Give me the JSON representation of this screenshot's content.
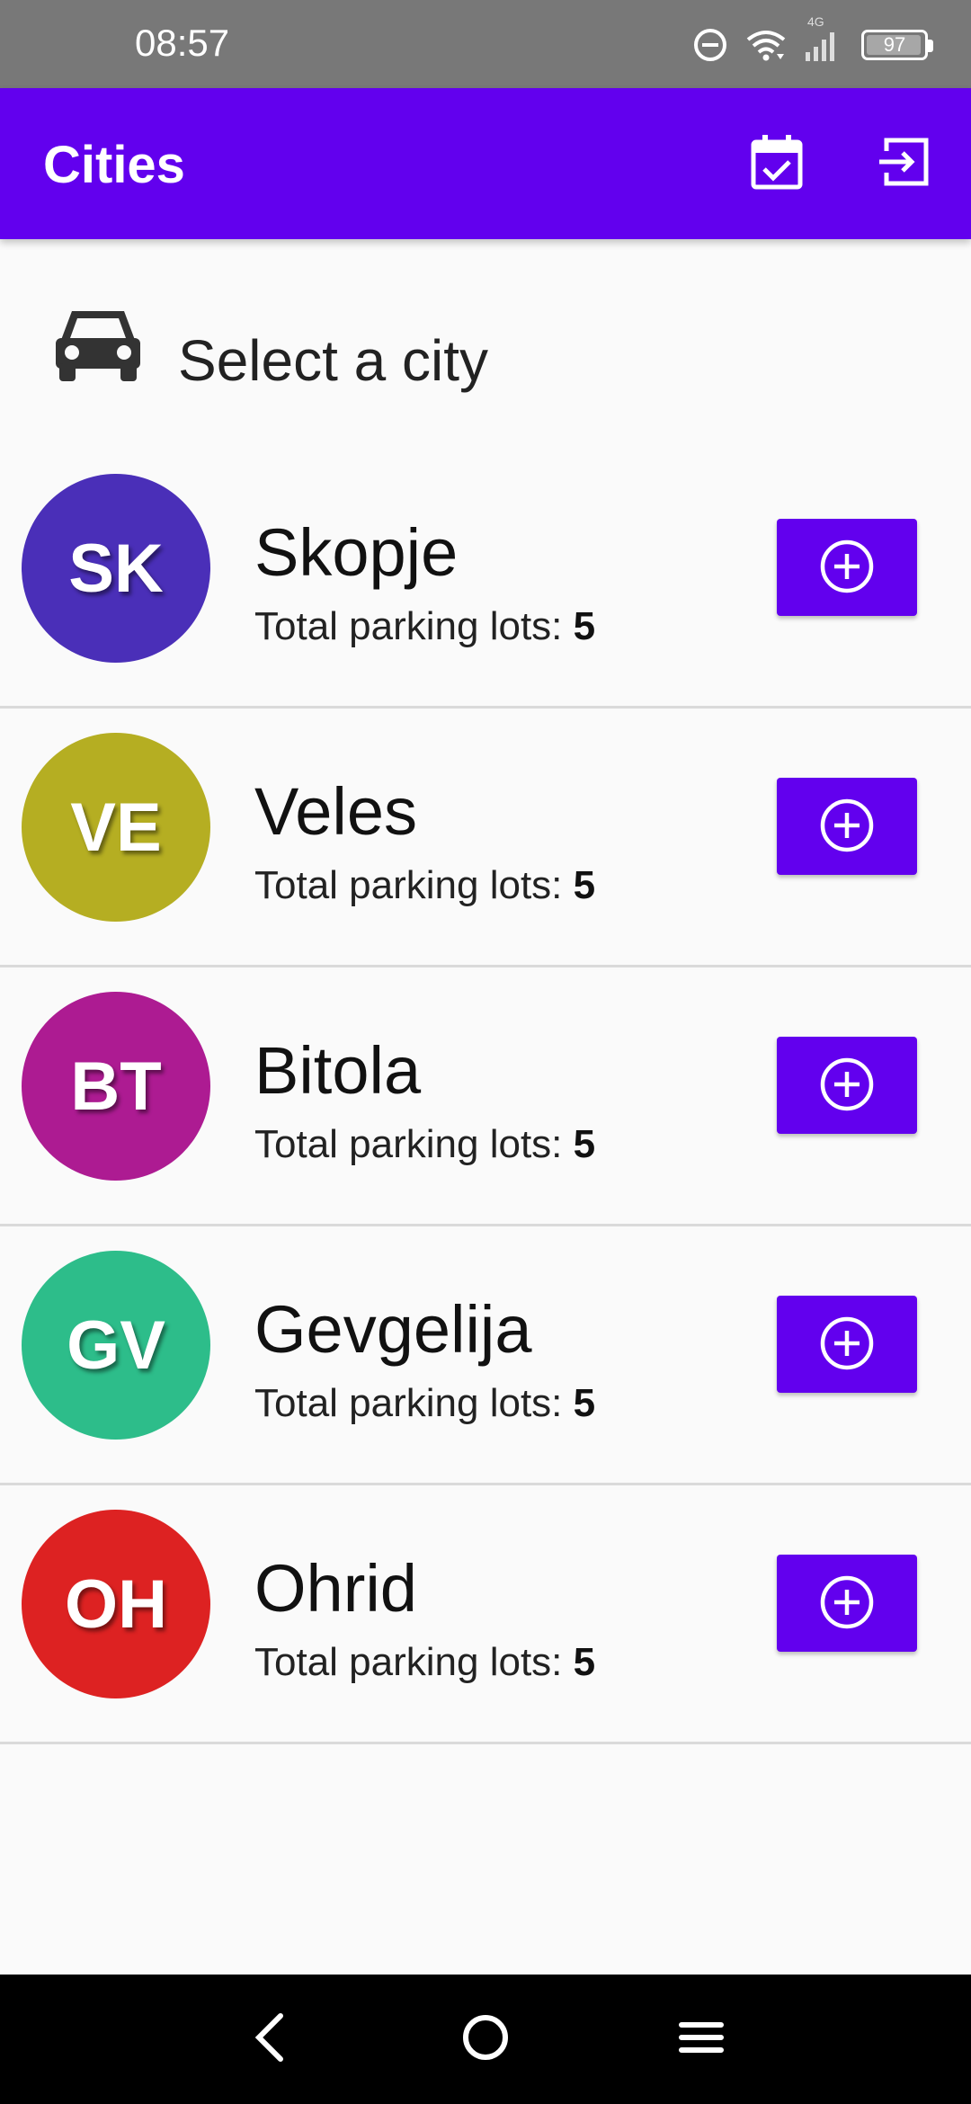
{
  "status_bar": {
    "time": "08:57",
    "network_label": "4G",
    "battery_level": "97",
    "icons": [
      "do-not-disturb-icon",
      "wifi-icon",
      "signal-icon",
      "battery-icon"
    ]
  },
  "app_bar": {
    "title": "Cities",
    "actions": [
      "calendar-check-icon",
      "logout-icon"
    ],
    "color": "#6200ee"
  },
  "header": {
    "label": "Select a city",
    "icon": "car-icon"
  },
  "cities": [
    {
      "initials": "SK",
      "name": "Skopje",
      "lots_label": "Total parking lots: ",
      "lots_value": "5",
      "color": "#4a2fb8"
    },
    {
      "initials": "VE",
      "name": "Veles",
      "lots_label": "Total parking lots: ",
      "lots_value": "5",
      "color": "#b5ae22"
    },
    {
      "initials": "BT",
      "name": "Bitola",
      "lots_label": "Total parking lots: ",
      "lots_value": "5",
      "color": "#ad1b92"
    },
    {
      "initials": "GV",
      "name": "Gevgelija",
      "lots_label": "Total parking lots: ",
      "lots_value": "5",
      "color": "#2dbd8a"
    },
    {
      "initials": "OH",
      "name": "Ohrid",
      "lots_label": "Total parking lots: ",
      "lots_value": "5",
      "color": "#dd2222"
    }
  ],
  "nav_bar": {
    "buttons": [
      "back-icon",
      "home-icon",
      "menu-icon"
    ]
  }
}
